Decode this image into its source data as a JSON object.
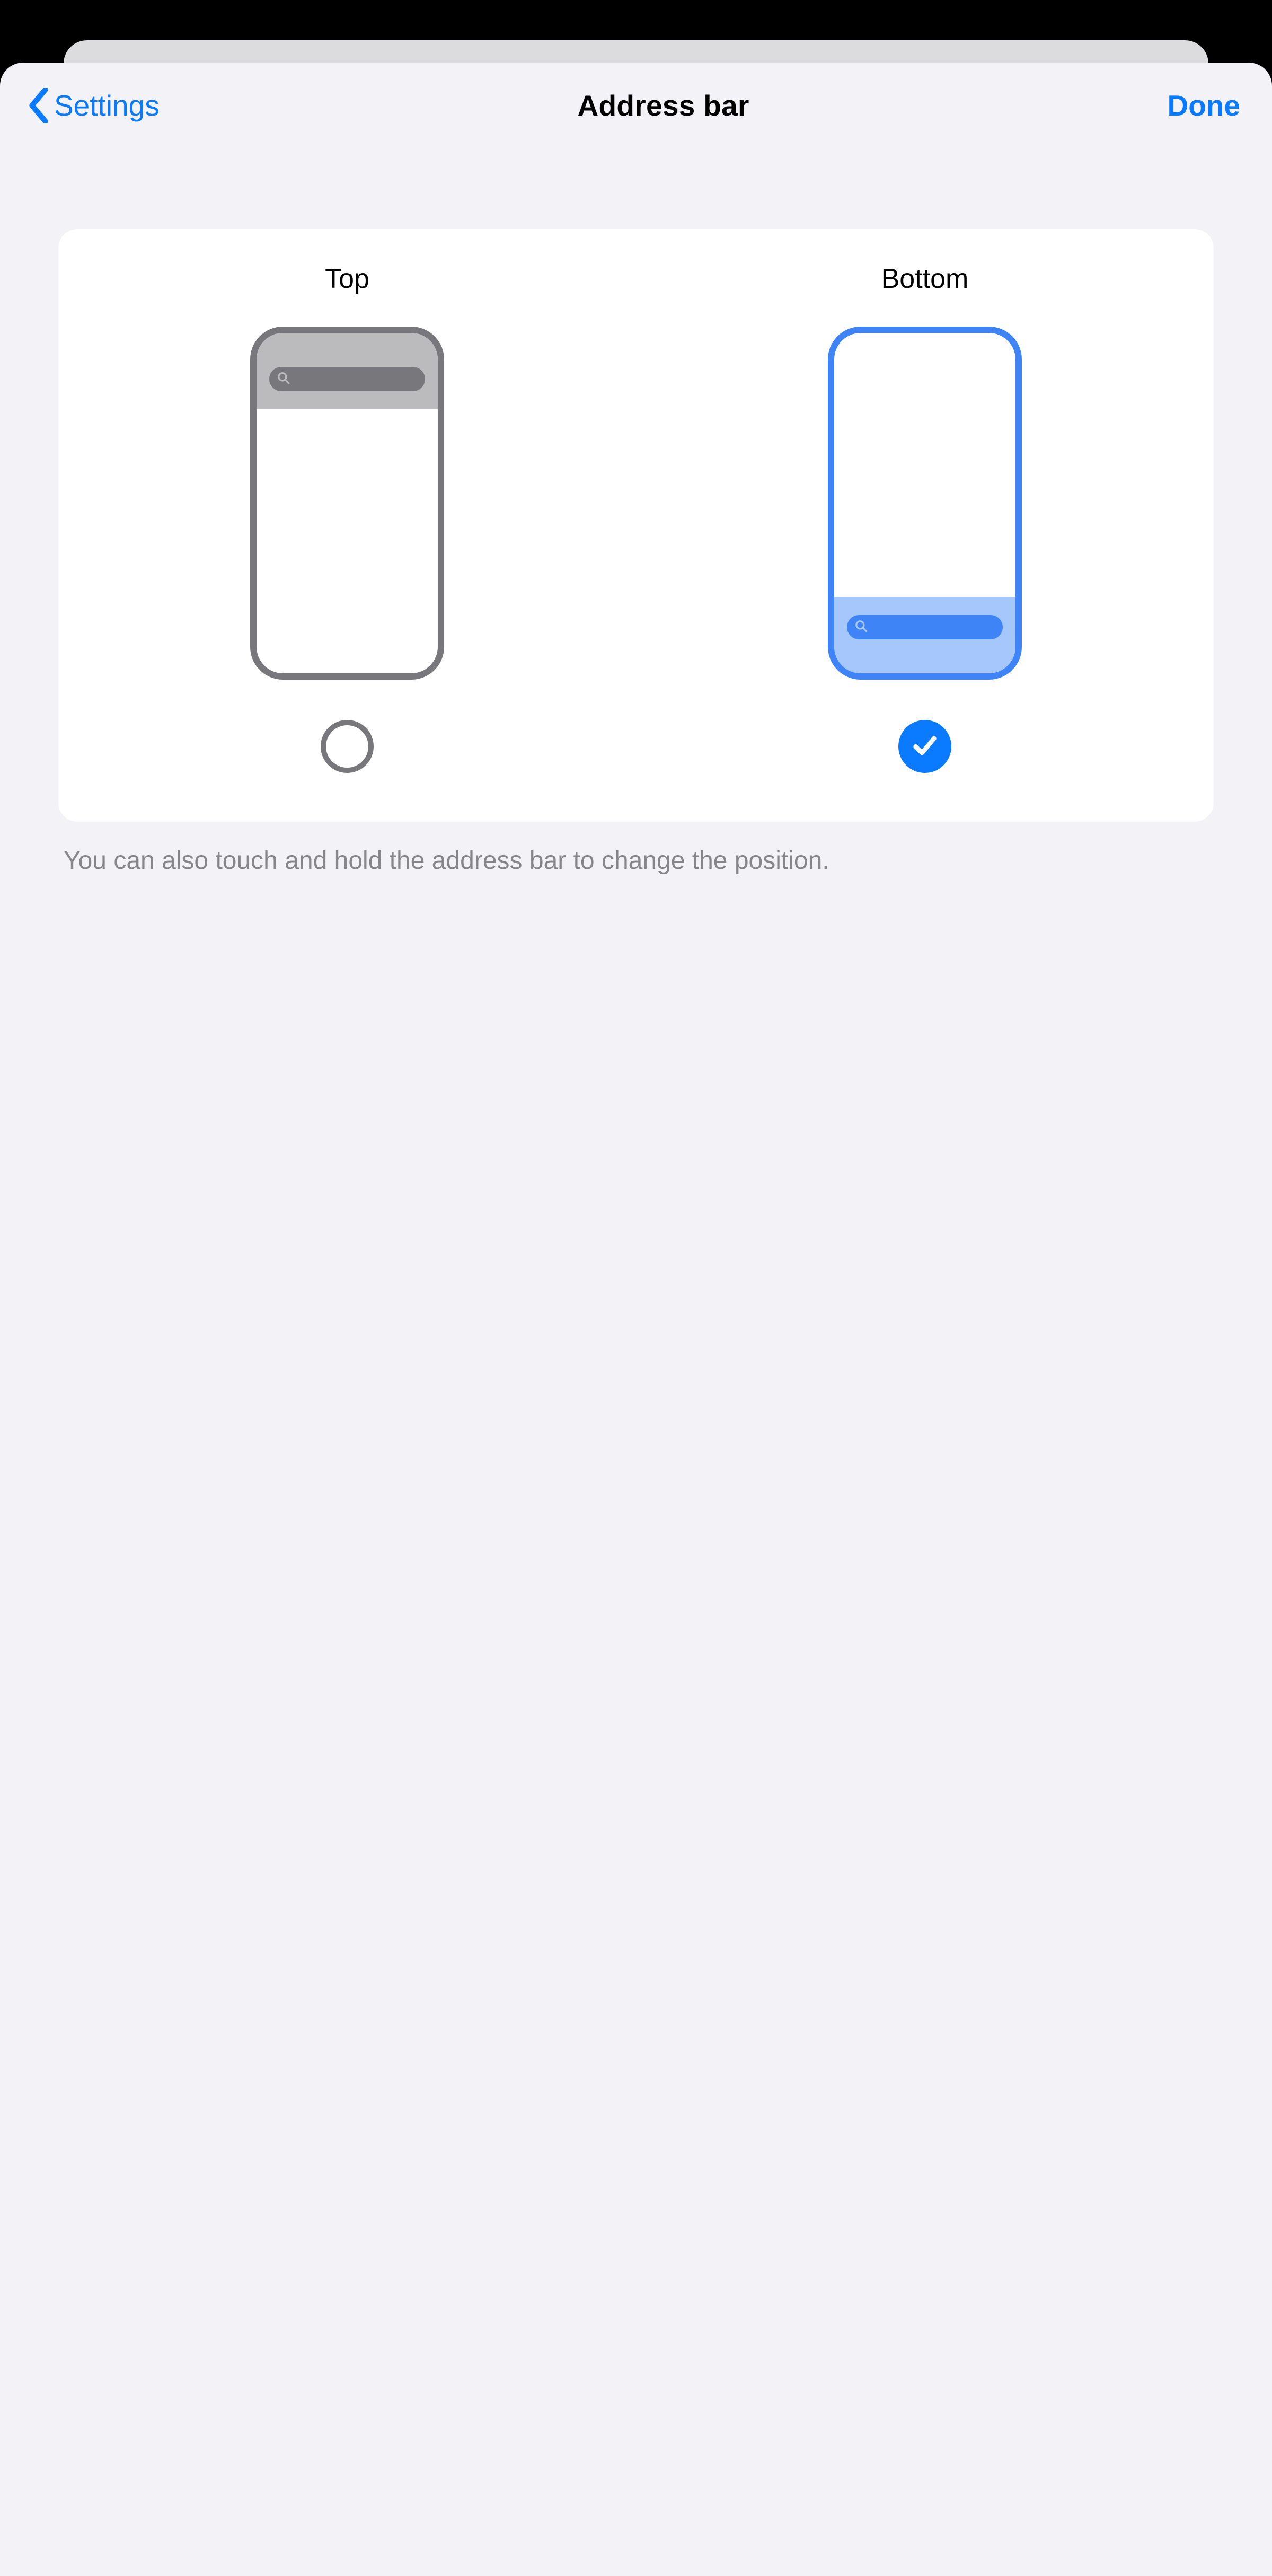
{
  "nav": {
    "back_label": "Settings",
    "title": "Address bar",
    "done_label": "Done"
  },
  "options": {
    "top": {
      "label": "Top",
      "selected": false
    },
    "bottom": {
      "label": "Bottom",
      "selected": true
    }
  },
  "footnote": "You can also touch and hold the address bar to change the position.",
  "colors": {
    "accent": "#0a7aff",
    "preview_selected": "#3e84f7",
    "preview_unselected": "#77777c",
    "sheet_bg": "#f2f2f7"
  }
}
